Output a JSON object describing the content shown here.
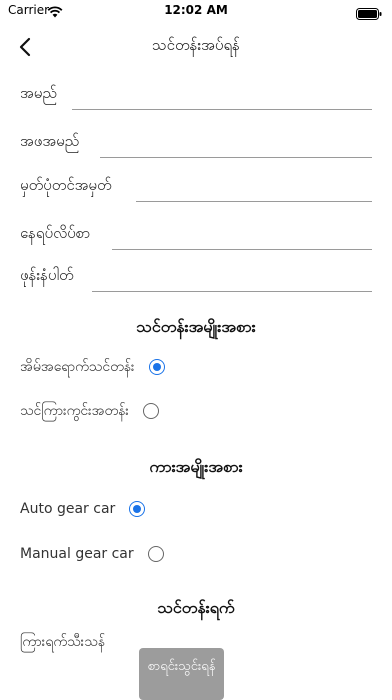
{
  "status_bar": {
    "carrier": "Carrier",
    "time": "12:02 AM"
  },
  "nav": {
    "title": "သင်တန်းအပ်ရန်"
  },
  "form": {
    "name_label": "အမည်",
    "father_name_label": "အဖအမည်",
    "nrc_label": "မှတ်ပုံတင်အမှတ်",
    "address_label": "နေရပ်လိပ်စာ",
    "phone_label": "ဖုန်းနံပါတ်"
  },
  "course_type": {
    "title": "သင်တန်းအမျိုးအစား",
    "options": [
      {
        "label": "အိမ်အရောက်သင်တန်း",
        "selected": true
      },
      {
        "label": "သင်ကြားကွင်းအတန်း",
        "selected": false
      }
    ]
  },
  "car_type": {
    "title": "ကားအမျိုးအစား",
    "options": [
      {
        "label": "Auto gear car",
        "selected": true
      },
      {
        "label": "Manual gear car",
        "selected": false
      }
    ]
  },
  "course_date": {
    "title": "သင်တန်းရက်",
    "start_label": "ကြားရက်သီးသန်",
    "button_label": "စာရင်းသွင်းရန်"
  },
  "colors": {
    "accent": "#1a73e8",
    "button_bg": "#9c9c9c"
  }
}
